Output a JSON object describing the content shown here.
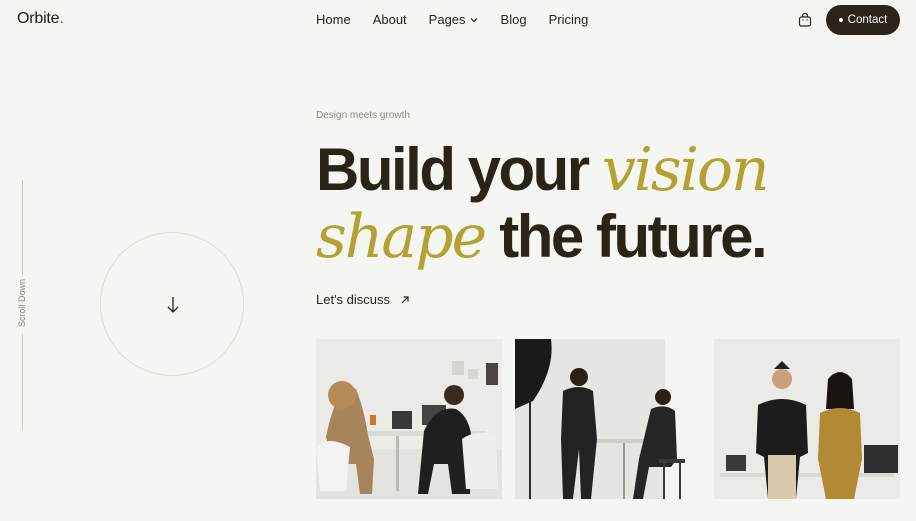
{
  "header": {
    "logo": "Orbite",
    "logo_dot": ".",
    "nav": [
      "Home",
      "About",
      "Pages",
      "Blog",
      "Pricing"
    ],
    "contact_label": "Contact"
  },
  "side": {
    "scroll_label": "Scroll Down"
  },
  "hero": {
    "eyebrow": "Design meets growth",
    "line1_plain": "Build your",
    "line1_accent": "vision",
    "line2_accent": "shape",
    "line2_plain": "the future.",
    "cta": "Let's discuss"
  },
  "colors": {
    "background": "#f5f5f2",
    "text": "#2a2318",
    "accent": "#b3a233",
    "button": "#2b241a"
  },
  "icons": [
    "chevron-down-icon",
    "cart-icon",
    "arrow-down-icon",
    "arrow-up-right-icon"
  ]
}
